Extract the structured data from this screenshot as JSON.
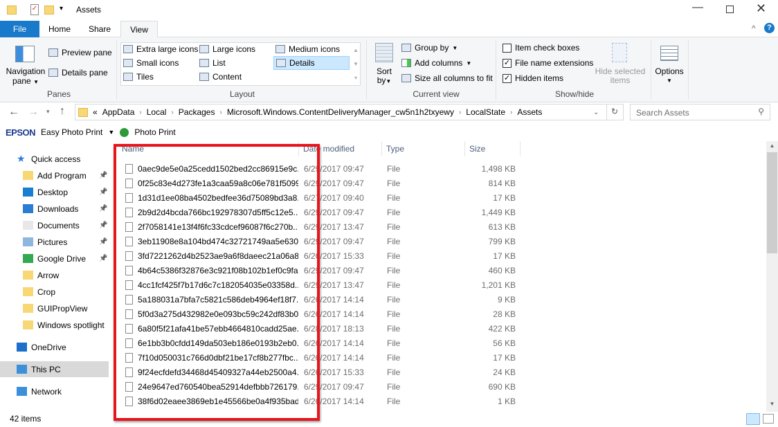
{
  "window": {
    "title": "Assets"
  },
  "tabs": [
    {
      "label": "File"
    },
    {
      "label": "Home"
    },
    {
      "label": "Share"
    },
    {
      "label": "View"
    }
  ],
  "ribbon": {
    "panes": {
      "navigation_pane": "Navigation",
      "navigation_pane2": "pane",
      "preview_pane": "Preview pane",
      "details_pane": "Details pane",
      "label": "Panes"
    },
    "layout": {
      "items": [
        "Extra large icons",
        "Large icons",
        "Medium icons",
        "Small icons",
        "List",
        "Details",
        "Tiles",
        "Content"
      ],
      "selected": "Details",
      "label": "Layout"
    },
    "current_view": {
      "sort": "Sort",
      "sort2": "by",
      "group_by": "Group by",
      "add_columns": "Add columns",
      "size_all": "Size all columns to fit",
      "label": "Current view"
    },
    "show_hide": {
      "item_check_boxes": "Item check boxes",
      "file_name_extensions": "File name extensions",
      "hidden_items": "Hidden items",
      "hide_selected": "Hide selected",
      "hide_selected2": "items",
      "label": "Show/hide"
    },
    "options": {
      "label": "Options"
    }
  },
  "address": {
    "prefix": "«",
    "crumbs": [
      "AppData",
      "Local",
      "Packages",
      "Microsoft.Windows.ContentDeliveryManager_cw5n1h2txyewy",
      "LocalState",
      "Assets"
    ],
    "search_placeholder": "Search Assets"
  },
  "epson": {
    "brand": "EPSON",
    "easy_photo_print": "Easy Photo Print",
    "photo_print": "Photo Print"
  },
  "sidebar": {
    "items": [
      {
        "label": "Quick access",
        "icon": "star-icon"
      },
      {
        "label": "Add Program",
        "icon": "folder-icon",
        "pinned": true
      },
      {
        "label": "Desktop",
        "icon": "desktop-icon",
        "pinned": true
      },
      {
        "label": "Downloads",
        "icon": "download-icon",
        "pinned": true
      },
      {
        "label": "Documents",
        "icon": "documents-icon",
        "pinned": true
      },
      {
        "label": "Pictures",
        "icon": "pictures-icon",
        "pinned": true
      },
      {
        "label": "Google Drive",
        "icon": "google-drive-icon",
        "pinned": true
      },
      {
        "label": "Arrow",
        "icon": "folder-icon"
      },
      {
        "label": "Crop",
        "icon": "folder-icon"
      },
      {
        "label": "GUIPropView",
        "icon": "folder-icon"
      },
      {
        "label": "Windows spotlight",
        "icon": "folder-icon"
      },
      {
        "label": "OneDrive",
        "icon": "cloud-icon"
      },
      {
        "label": "This PC",
        "icon": "computer-icon",
        "selected": true
      },
      {
        "label": "Network",
        "icon": "network-icon"
      }
    ]
  },
  "columns": [
    "Name",
    "Date modified",
    "Type",
    "Size"
  ],
  "files": [
    [
      "0aec9de5e0a25cedd1502bed2cc86915e9c...",
      "6/29/2017 09:47",
      "File",
      "1,498 KB"
    ],
    [
      "0f25c83e4d273fe1a3caa59a8c06e781f5099...",
      "6/29/2017 09:47",
      "File",
      "814 KB"
    ],
    [
      "1d31d1ee08ba4502bedfee36d75089bd3a8...",
      "6/27/2017 09:40",
      "File",
      "17 KB"
    ],
    [
      "2b9d2d4bcda766bc192978307d5ff5c12e5...",
      "6/29/2017 09:47",
      "File",
      "1,449 KB"
    ],
    [
      "2f7058141e13f4f6fc33cdcef96087f6c270b...",
      "6/29/2017 13:47",
      "File",
      "613 KB"
    ],
    [
      "3eb11908e8a104bd474c32721749aa5e630...",
      "6/29/2017 09:47",
      "File",
      "799 KB"
    ],
    [
      "3fd7221262d4b2523ae9a6f8daeec21a06a8...",
      "6/26/2017 15:33",
      "File",
      "17 KB"
    ],
    [
      "4b64c5386f32876e3c921f08b102b1ef0c9fa...",
      "6/29/2017 09:47",
      "File",
      "460 KB"
    ],
    [
      "4cc1fcf425f7b17d6c7c182054035e03358d...",
      "6/29/2017 13:47",
      "File",
      "1,201 KB"
    ],
    [
      "5a188031a7bfa7c5821c586deb4964ef18f7...",
      "6/26/2017 14:14",
      "File",
      "9 KB"
    ],
    [
      "5f0d3a275d432982e0e093bc59c242df83b0...",
      "6/26/2017 14:14",
      "File",
      "28 KB"
    ],
    [
      "6a80f5f21afa41be57ebb4664810cadd25ae...",
      "6/28/2017 18:13",
      "File",
      "422 KB"
    ],
    [
      "6e1bb3b0cfdd149da503eb186e0193b2eb0...",
      "6/26/2017 14:14",
      "File",
      "56 KB"
    ],
    [
      "7f10d050031c766d0dbf21be17cf8b277fbc...",
      "6/26/2017 14:14",
      "File",
      "17 KB"
    ],
    [
      "9f24ecfdefd34468d45409327a44eb2500a4...",
      "6/26/2017 15:33",
      "File",
      "24 KB"
    ],
    [
      "24e9647ed760540bea52914defbbb726179...",
      "6/29/2017 09:47",
      "File",
      "690 KB"
    ],
    [
      "38f6d02eaee3869eb1e45566be0a4f935bad...",
      "6/26/2017 14:14",
      "File",
      "1 KB"
    ]
  ],
  "status": {
    "count": "42 items"
  },
  "colors": {
    "file_tab": "#1979ca",
    "selection": "#cce8ff",
    "highlight_box": "#e8141b"
  }
}
